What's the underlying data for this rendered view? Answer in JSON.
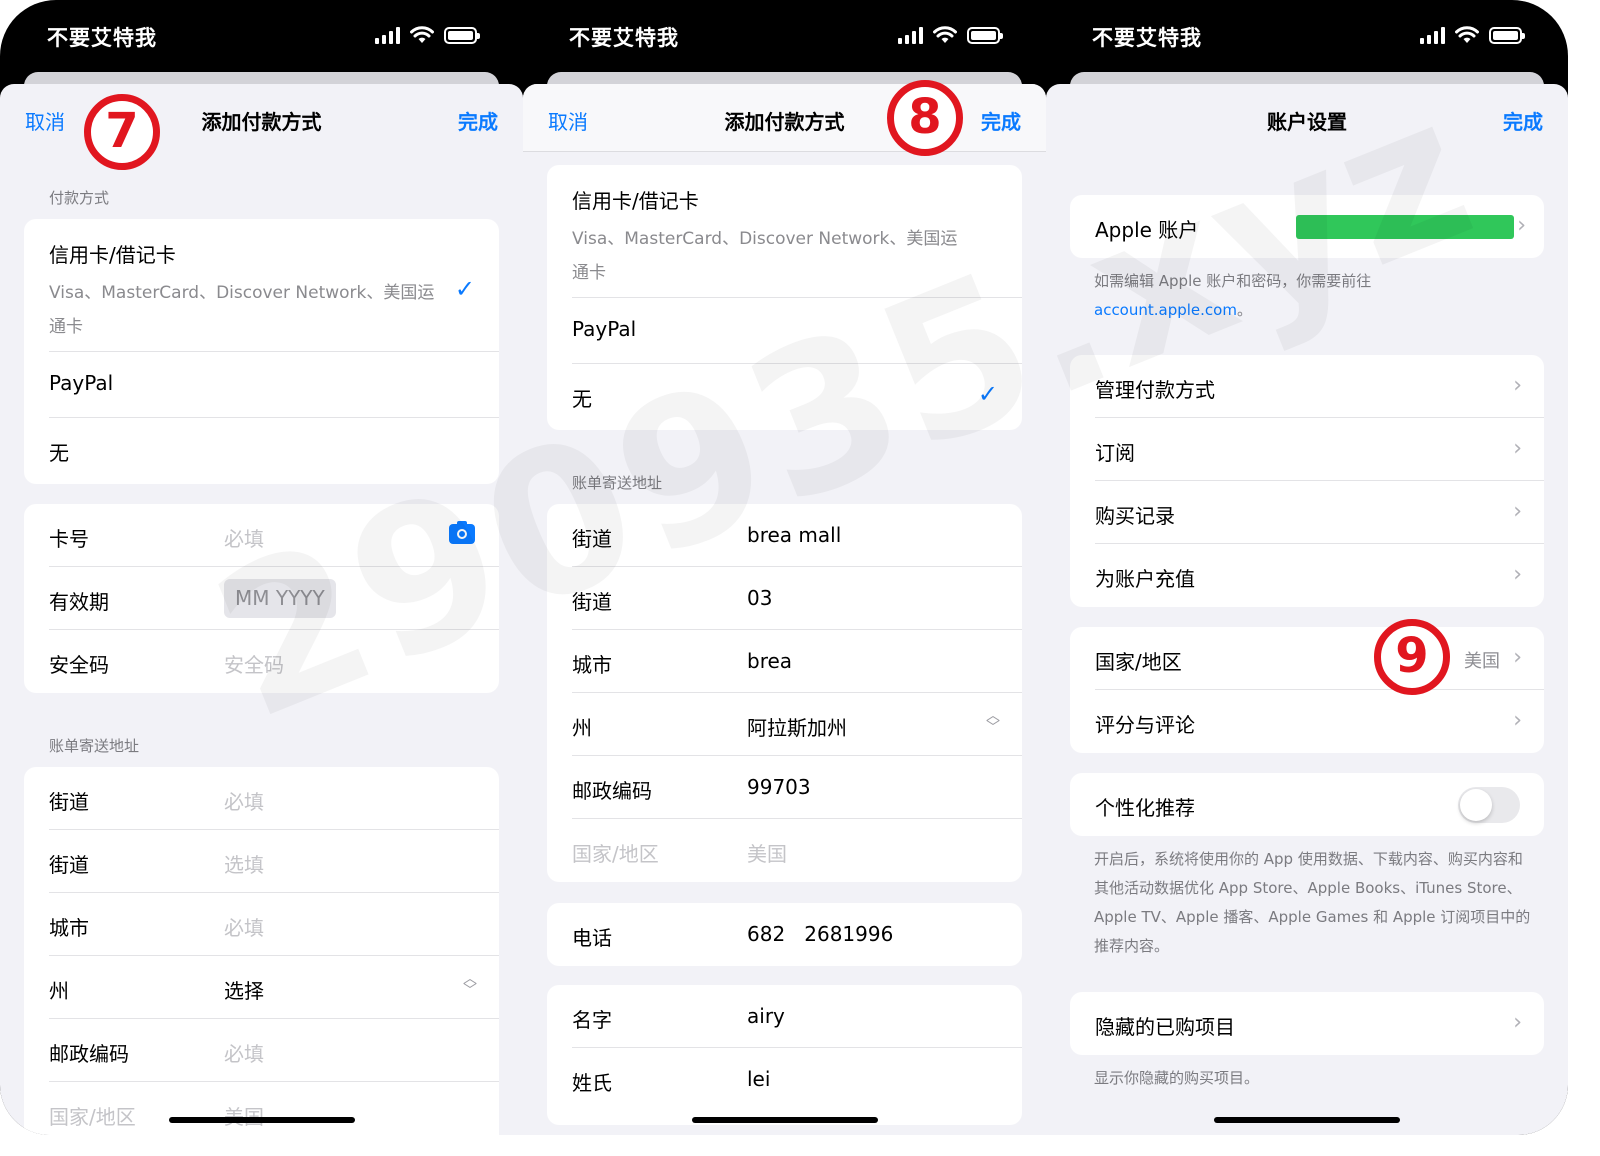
{
  "status_bar": {
    "carrier": "不要艾特我"
  },
  "watermark": "290935.xyz",
  "colors": {
    "accent": "#0a7aff",
    "badge_red": "#e1161f",
    "bar_green": "#30c75a"
  },
  "screen1": {
    "nav": {
      "cancel": "取消",
      "title": "添加付款方式",
      "done": "完成"
    },
    "step_badge": "7",
    "payment_header": "付款方式",
    "payment_options": [
      {
        "title": "信用卡/借记卡",
        "subtitle": "Visa、MasterCard、Discover Network、美国运通卡",
        "selected": true
      },
      {
        "title": "PayPal"
      },
      {
        "title": "无"
      }
    ],
    "card": {
      "number_label": "卡号",
      "number_placeholder": "必填",
      "expiry_label": "有效期",
      "expiry_placeholder": "MM YYYY",
      "cvv_label": "安全码",
      "cvv_placeholder": "安全码"
    },
    "billing_header": "账单寄送地址",
    "billing": [
      {
        "label": "街道",
        "value": "必填"
      },
      {
        "label": "街道",
        "value": "选填"
      },
      {
        "label": "城市",
        "value": "必填"
      },
      {
        "label": "州",
        "value": "选择"
      },
      {
        "label": "邮政编码",
        "value": "必填"
      },
      {
        "label": "国家/地区",
        "value": "美国"
      }
    ]
  },
  "screen2": {
    "nav": {
      "cancel": "取消",
      "title": "添加付款方式",
      "done": "完成"
    },
    "step_badge": "8",
    "payment_options": [
      {
        "title": "信用卡/借记卡",
        "subtitle": "Visa、MasterCard、Discover Network、美国运通卡"
      },
      {
        "title": "PayPal"
      },
      {
        "title": "无",
        "selected": true
      }
    ],
    "billing_header": "账单寄送地址",
    "billing": [
      {
        "label": "街道",
        "value": "brea mall"
      },
      {
        "label": "街道",
        "value": "03"
      },
      {
        "label": "城市",
        "value": "brea"
      },
      {
        "label": "州",
        "value": "阿拉斯加州"
      },
      {
        "label": "邮政编码",
        "value": "99703"
      },
      {
        "label": "国家/地区",
        "value": "美国"
      }
    ],
    "phone": {
      "label": "电话",
      "value": "682   2681996"
    },
    "name": [
      {
        "label": "名字",
        "value": "airy"
      },
      {
        "label": "姓氏",
        "value": "lei"
      }
    ]
  },
  "screen3": {
    "nav": {
      "title": "账户设置",
      "done": "完成"
    },
    "step_badge": "9",
    "apple_account": {
      "label": "Apple 账户"
    },
    "apple_footer": {
      "text": "如需编辑 Apple 账户和密码，你需要前往",
      "link": "account.apple.com",
      "suffix": "。"
    },
    "menu": [
      {
        "label": "管理付款方式"
      },
      {
        "label": "订阅"
      },
      {
        "label": "购买记录"
      },
      {
        "label": "为账户充值"
      }
    ],
    "region": {
      "label": "国家/地区",
      "value": "美国"
    },
    "ratings": {
      "label": "评分与评论"
    },
    "personalized": {
      "label": "个性化推荐",
      "on": false
    },
    "personalized_footer": "开启后，系统将使用你的 App 使用数据、下载内容、购买内容和其他活动数据优化 App Store、Apple Books、iTunes Store、Apple TV、Apple 播客、Apple Games 和 Apple 订阅项目中的推荐内容。",
    "hidden": {
      "label": "隐藏的已购项目"
    },
    "hidden_footer": "显示你隐藏的购买项目。"
  }
}
